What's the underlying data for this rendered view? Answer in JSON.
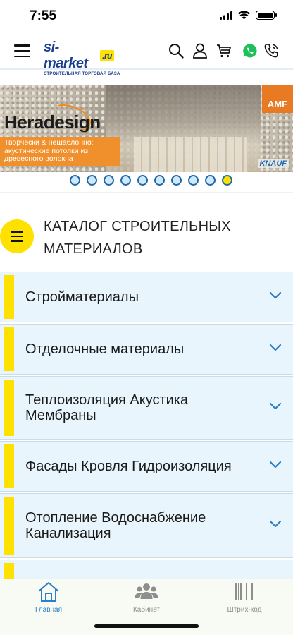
{
  "status": {
    "time": "7:55"
  },
  "header": {
    "logo_main": "si-market",
    "logo_tld": ".ru",
    "logo_tagline": "СТРОИТЕЛЬНАЯ ТОРГОВАЯ БАЗА",
    "icons": [
      "menu-icon",
      "search-icon",
      "user-icon",
      "cart-icon",
      "whatsapp-icon",
      "phone-icon"
    ]
  },
  "banner": {
    "brand": "Heradesign",
    "tagline": "Творчески & нешаблонно: акустические потолки из древесного волокна",
    "badge": "AMF",
    "partner": "KNAUF",
    "slides_total": 10,
    "active_slide": 10
  },
  "catalog": {
    "title": "КАТАЛОГ СТРОИТЕЛЬНЫХ МАТЕРИАЛОВ",
    "items": [
      {
        "label": "Стройматериалы"
      },
      {
        "label": "Отделочные материалы"
      },
      {
        "label": "Теплоизоляция Акустика Мембраны"
      },
      {
        "label": "Фасады Кровля Гидроизоляция"
      },
      {
        "label": "Отопление Водоснабжение Канализация"
      },
      {
        "label": ""
      }
    ]
  },
  "tabbar": {
    "tabs": [
      {
        "label": "Главная",
        "active": true
      },
      {
        "label": "Кабинет",
        "active": false
      },
      {
        "label": "Штрих-код",
        "active": false
      }
    ]
  },
  "colors": {
    "accent": "#ffe100",
    "brand_blue": "#1c3f8f",
    "link_blue": "#2a7fc6",
    "list_bg": "#e8f5fd"
  }
}
